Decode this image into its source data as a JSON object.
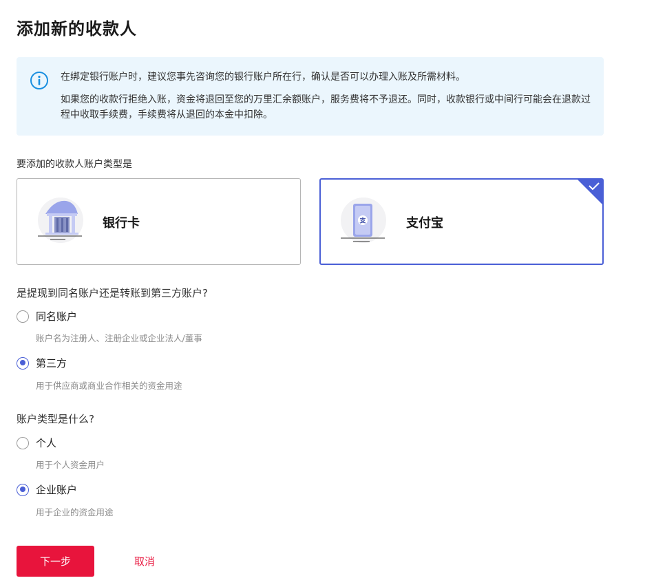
{
  "page": {
    "title": "添加新的收款人"
  },
  "notice": {
    "line1": "在绑定银行账户时，建议您事先咨询您的银行账户所在行，确认是否可以办理入账及所需材料。",
    "line2": "如果您的收款行拒绝入账，资金将退回至您的万里汇余额账户，服务费将不予退还。同时，收款银行或中间行可能会在退款过程中收取手续费，手续费将从退回的本金中扣除。"
  },
  "account_type": {
    "question": "要添加的收款人账户类型是",
    "options": [
      {
        "label": "银行卡",
        "icon": "bank-icon",
        "selected": false
      },
      {
        "label": "支付宝",
        "icon": "alipay-phone-icon",
        "selected": true
      }
    ]
  },
  "transfer_target": {
    "question": "是提现到同名账户还是转账到第三方账户?",
    "options": [
      {
        "label": "同名账户",
        "desc": "账户名为注册人、注册企业或企业法人/董事",
        "checked": false
      },
      {
        "label": "第三方",
        "desc": "用于供应商或商业合作相关的资金用途",
        "checked": true
      }
    ]
  },
  "holder_type": {
    "question": "账户类型是什么?",
    "options": [
      {
        "label": "个人",
        "desc": "用于个人资金用户",
        "checked": false
      },
      {
        "label": "企业账户",
        "desc": "用于企业的资金用途",
        "checked": true
      }
    ]
  },
  "actions": {
    "next": "下一步",
    "cancel": "取消"
  },
  "colors": {
    "accent": "#4a5fd6",
    "primary_button": "#e8143c",
    "notice_bg": "#ebf6fd"
  }
}
